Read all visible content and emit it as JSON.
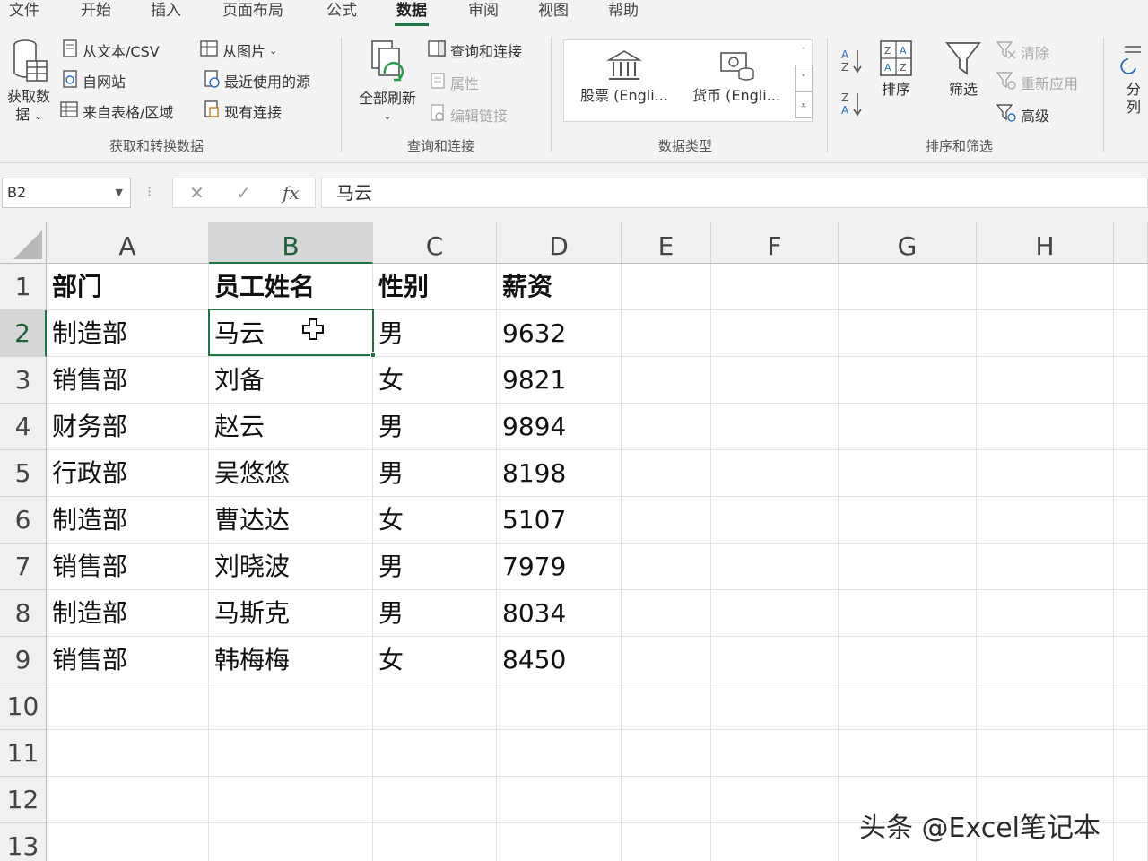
{
  "tabs": [
    "文件",
    "开始",
    "插入",
    "页面布局",
    "公式",
    "数据",
    "审阅",
    "视图",
    "帮助"
  ],
  "active_tab": "数据",
  "ribbon": {
    "get_transform": {
      "get_data_line1": "获取数",
      "get_data_line2": "据",
      "from_text": "从文本/CSV",
      "from_web": "自网站",
      "from_table": "来自表格/区域",
      "from_picture": "从图片",
      "recent_sources": "最近使用的源",
      "existing_connections": "现有连接",
      "group_label": "获取和转换数据"
    },
    "queries": {
      "refresh_all": "全部刷新",
      "queries_connections": "查询和连接",
      "properties": "属性",
      "edit_links": "编辑链接",
      "group_label": "查询和连接"
    },
    "data_types": {
      "stocks": "股票 (Engli...",
      "currency": "货币 (Engli...",
      "group_label": "数据类型"
    },
    "sort_filter": {
      "sort": "排序",
      "filter": "筛选",
      "clear": "清除",
      "reapply": "重新应用",
      "advanced": "高级",
      "group_label": "排序和筛选"
    },
    "split_partial": "分列"
  },
  "formula_bar": {
    "name_box": "B2",
    "formula": "马云"
  },
  "columns": [
    "A",
    "B",
    "C",
    "D",
    "E",
    "F",
    "G",
    "H"
  ],
  "selected_column": "B",
  "rows": [
    "1",
    "2",
    "3",
    "4",
    "5",
    "6",
    "7",
    "8",
    "9",
    "10",
    "11",
    "12",
    "13"
  ],
  "selected_row": "2",
  "table": {
    "headers": [
      "部门",
      "员工姓名",
      "性别",
      "薪资"
    ],
    "rows": [
      [
        "制造部",
        "马云",
        "男",
        "9632"
      ],
      [
        "销售部",
        "刘备",
        "女",
        "9821"
      ],
      [
        "财务部",
        "赵云",
        "男",
        "9894"
      ],
      [
        "行政部",
        "吴悠悠",
        "男",
        "8198"
      ],
      [
        "制造部",
        "曹达达",
        "女",
        "5107"
      ],
      [
        "销售部",
        "刘晓波",
        "男",
        "7979"
      ],
      [
        "制造部",
        "马斯克",
        "男",
        "8034"
      ],
      [
        "销售部",
        "韩梅梅",
        "女",
        "8450"
      ]
    ]
  },
  "watermark": "头条 @Excel笔记本"
}
